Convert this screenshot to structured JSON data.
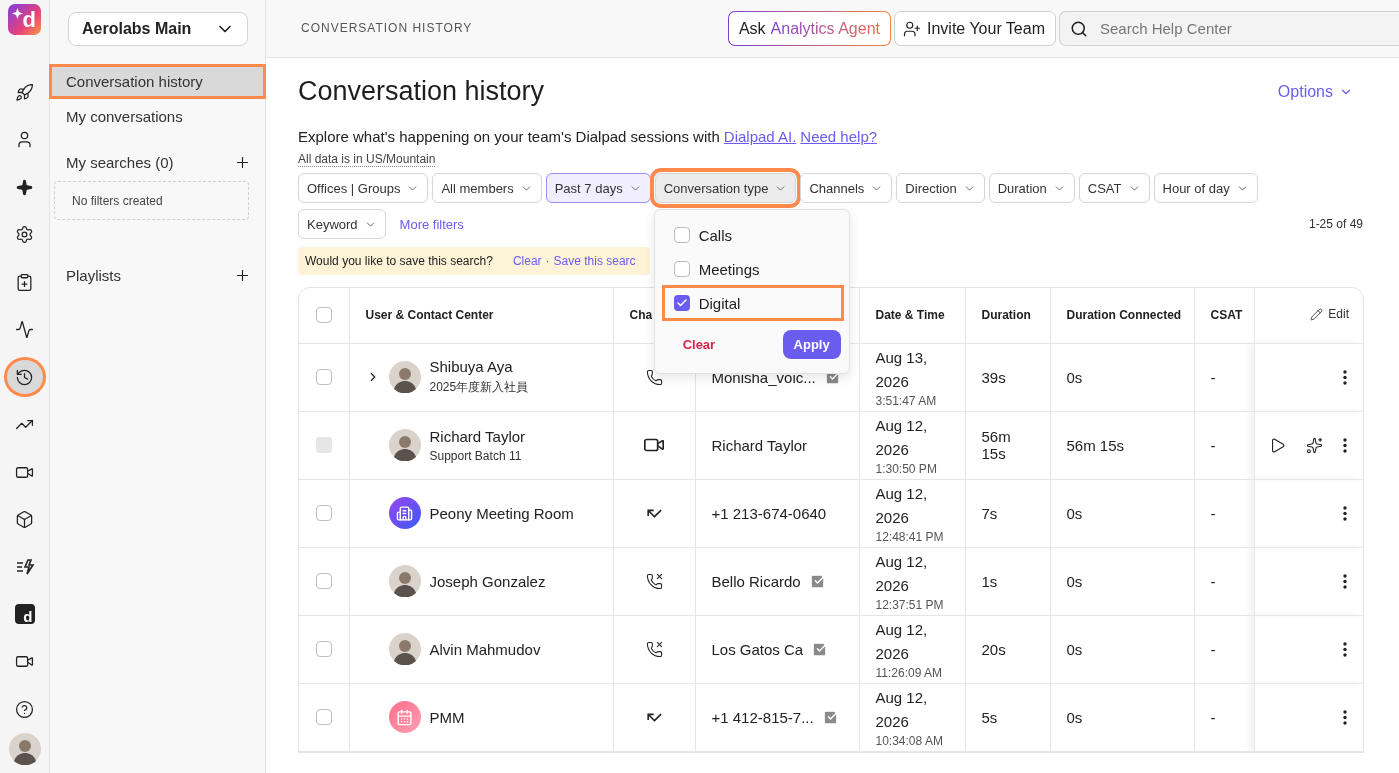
{
  "rail": {
    "logo": "d",
    "items": [
      {
        "kind": "rocket",
        "selected": false,
        "highlighted": false
      },
      {
        "kind": "user",
        "selected": false,
        "highlighted": false
      },
      {
        "kind": "sparkle",
        "selected": false,
        "highlighted": false
      },
      {
        "kind": "settings",
        "selected": false,
        "highlighted": false
      },
      {
        "kind": "clipboard",
        "selected": false,
        "highlighted": false
      },
      {
        "kind": "activity",
        "selected": false,
        "highlighted": false
      },
      {
        "kind": "history",
        "selected": true,
        "highlighted": true
      },
      {
        "kind": "trending",
        "selected": false,
        "highlighted": false
      },
      {
        "kind": "video-settings",
        "selected": false,
        "highlighted": false
      },
      {
        "kind": "box",
        "selected": false,
        "highlighted": false
      },
      {
        "kind": "list-bolt",
        "selected": false,
        "highlighted": false
      },
      {
        "kind": "brand",
        "label": "d",
        "selected": false,
        "highlighted": false
      },
      {
        "kind": "video",
        "selected": false,
        "highlighted": false
      },
      {
        "kind": "help",
        "selected": false,
        "highlighted": false
      }
    ]
  },
  "workspace": {
    "name": "Aerolabs Main"
  },
  "nav": {
    "items": [
      {
        "label": "Conversation history",
        "selected": true,
        "highlighted": true
      },
      {
        "label": "My conversations",
        "selected": false,
        "highlighted": false
      }
    ],
    "searches": {
      "label": "My searches (0)",
      "empty": "No filters created"
    },
    "playlists": {
      "label": "Playlists"
    }
  },
  "topbar": {
    "breadcrumb": "CONVERSATION HISTORY",
    "ask": {
      "prefix": "Ask",
      "agent": "Analytics Agent"
    },
    "invite": "Invite Your Team",
    "search": {
      "placeholder": "Search Help Center"
    }
  },
  "page": {
    "title": "Conversation history",
    "options": "Options",
    "intro": "Explore what's happening on your team's Dialpad sessions with",
    "links": [
      "Dialpad AI.",
      "Need help?"
    ],
    "timezone": "All data is in US/Mountain"
  },
  "filter_rows": [
    [
      {
        "label": "Offices | Groups",
        "active": false,
        "open": false,
        "highlighted": false
      },
      {
        "label": "All members",
        "active": false,
        "open": false,
        "highlighted": false
      },
      {
        "label": "Past 7 days",
        "active": true,
        "open": false,
        "highlighted": false
      },
      {
        "label": "Conversation type",
        "active": false,
        "open": true,
        "highlighted": true
      },
      {
        "label": "Channels",
        "active": false,
        "open": false,
        "highlighted": false
      },
      {
        "label": "Direction",
        "active": false,
        "open": false,
        "highlighted": false
      },
      {
        "label": "Duration",
        "active": false,
        "open": false,
        "highlighted": false
      },
      {
        "label": "CSAT",
        "active": false,
        "open": false,
        "highlighted": false
      },
      {
        "label": "Hour of day",
        "active": false,
        "open": false,
        "highlighted": false
      }
    ],
    [
      {
        "label": "Keyword",
        "active": false,
        "open": false,
        "highlighted": false
      }
    ]
  ],
  "more_filters": "More filters",
  "range": "1-25 of 49",
  "save_banner": {
    "text": "Would you like to save this search?",
    "clear": "Clear",
    "separator": "·",
    "save": "Save this searc"
  },
  "dropdown": {
    "options": [
      {
        "label": "Calls",
        "checked": false,
        "highlighted": false
      },
      {
        "label": "Meetings",
        "checked": false,
        "highlighted": false
      },
      {
        "label": "Digital",
        "checked": true,
        "highlighted": true
      }
    ],
    "clear": "Clear",
    "apply": "Apply"
  },
  "table": {
    "all_checked": false,
    "columns": [
      "User & Contact Center",
      "Cha",
      "Date & Time",
      "Duration",
      "Duration Connected",
      "CSAT"
    ],
    "edit": "Edit",
    "rows": [
      {
        "checked": false,
        "disabled": false,
        "expandable": true,
        "avatar": {
          "kind": "photo"
        },
        "name": "Shibuya Aya",
        "subtitle": "2025年度新入社員",
        "channel": {
          "kind": "call"
        },
        "contact": "Monisha_voic...",
        "verified": true,
        "date": "Aug 13, 2026",
        "time": "3:51:47 AM",
        "duration": "39s",
        "connected": "0s",
        "csat": "-",
        "media": false
      },
      {
        "checked": false,
        "disabled": true,
        "expandable": false,
        "avatar": {
          "kind": "photo"
        },
        "name": "Richard Taylor",
        "subtitle": "Support Batch 11",
        "channel": {
          "kind": "video"
        },
        "contact": "Richard Taylor",
        "verified": false,
        "date": "Aug 12, 2026",
        "time": "1:30:50 PM",
        "duration": "56m 15s",
        "connected": "56m 15s",
        "csat": "-",
        "media": true
      },
      {
        "checked": false,
        "disabled": false,
        "expandable": false,
        "avatar": {
          "kind": "room"
        },
        "name": "Peony Meeting Room",
        "channel": {
          "kind": "hangup"
        },
        "contact": "+1 213-674-0640",
        "verified": false,
        "date": "Aug 12, 2026",
        "time": "12:48:41 PM",
        "duration": "7s",
        "connected": "0s",
        "csat": "-",
        "media": false
      },
      {
        "checked": false,
        "disabled": false,
        "expandable": false,
        "avatar": {
          "kind": "photo"
        },
        "name": "Joseph Gonzalez",
        "channel": {
          "kind": "missed"
        },
        "contact": "Bello Ricardo",
        "verified": true,
        "date": "Aug 12, 2026",
        "time": "12:37:51 PM",
        "duration": "1s",
        "connected": "0s",
        "csat": "-",
        "media": false
      },
      {
        "checked": false,
        "disabled": false,
        "expandable": false,
        "avatar": {
          "kind": "photo"
        },
        "name": "Alvin Mahmudov",
        "channel": {
          "kind": "missed"
        },
        "contact": "Los Gatos Ca",
        "verified": true,
        "date": "Aug 12, 2026",
        "time": "11:26:09 AM",
        "duration": "20s",
        "connected": "0s",
        "csat": "-",
        "media": false
      },
      {
        "checked": false,
        "disabled": false,
        "expandable": false,
        "avatar": {
          "kind": "calendar"
        },
        "name": "PMM",
        "channel": {
          "kind": "hangup"
        },
        "contact": "+1 412-815-7...",
        "verified": true,
        "date": "Aug 12, 2026",
        "time": "10:34:08 AM",
        "duration": "5s",
        "connected": "0s",
        "csat": "-",
        "media": false
      }
    ]
  }
}
